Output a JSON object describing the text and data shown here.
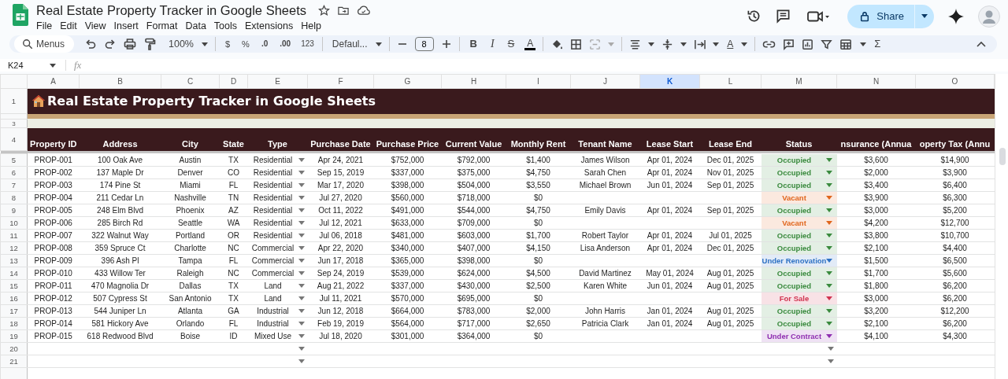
{
  "document": {
    "title": "Real Estate Property Tracker in Google Sheets"
  },
  "menu": [
    "File",
    "Edit",
    "View",
    "Insert",
    "Format",
    "Data",
    "Tools",
    "Extensions",
    "Help"
  ],
  "share": "Share",
  "toolbar": {
    "search_placeholder": "Menus",
    "zoom": "100%",
    "currency": "$",
    "percent": "%",
    "decimal_decrease": ".0",
    "decimal_increase": ".00",
    "number_format": "123",
    "font": "Defaul...",
    "font_size": "8",
    "bold": "B",
    "italic": "I",
    "strikethrough": "S",
    "text_color": "A",
    "text_rotation": "A",
    "functions": "Σ"
  },
  "formula_bar": {
    "name_box": "K24",
    "fx": "fx"
  },
  "columns": [
    {
      "letter": "A",
      "selected": false
    },
    {
      "letter": "B",
      "selected": false
    },
    {
      "letter": "C",
      "selected": false
    },
    {
      "letter": "D",
      "selected": false
    },
    {
      "letter": "E",
      "selected": false
    },
    {
      "letter": "F",
      "selected": false
    },
    {
      "letter": "G",
      "selected": false
    },
    {
      "letter": "H",
      "selected": false
    },
    {
      "letter": "I",
      "selected": false
    },
    {
      "letter": "J",
      "selected": false
    },
    {
      "letter": "K",
      "selected": true
    },
    {
      "letter": "L",
      "selected": false
    },
    {
      "letter": "M",
      "selected": false
    },
    {
      "letter": "N",
      "selected": false
    },
    {
      "letter": "O",
      "selected": false
    }
  ],
  "title_row": {
    "number": "1",
    "title": "Real Estate Property Tracker in Google Sheets"
  },
  "band_row_number": "3",
  "header_row": {
    "number": "4",
    "labels": [
      "Property ID",
      "Address",
      "City",
      "State",
      "Type",
      "Purchase Date",
      "Purchase Price",
      "Current Value",
      "Monthly Rent",
      "Tenant Name",
      "Lease Start",
      "Lease End",
      "Status",
      "nsurance (Annua",
      "operty Tax (Annu"
    ]
  },
  "rows": [
    {
      "number": "5",
      "id": "PROP-001",
      "address": "100 Oak Ave",
      "city": "Austin",
      "state": "TX",
      "type": "Residential",
      "purchase_date": "Apr 24, 2021",
      "purchase_price": "$752,000",
      "current_value": "$792,000",
      "monthly_rent": "$1,400",
      "tenant": "James Wilson",
      "lease_start": "Apr 01, 2024",
      "lease_end": "Dec 01, 2025",
      "status": "Occupied",
      "color": "#3a8a3e",
      "insurance": "$3,600",
      "property_tax": "$14,900"
    },
    {
      "number": "6",
      "id": "PROP-002",
      "address": "137 Maple Dr",
      "city": "Denver",
      "state": "CO",
      "type": "Residential",
      "purchase_date": "Sep 15, 2019",
      "purchase_price": "$337,000",
      "current_value": "$375,000",
      "monthly_rent": "$4,750",
      "tenant": "Sarah Chen",
      "lease_start": "Apr 01, 2024",
      "lease_end": "Nov 01, 2025",
      "status": "Occupied",
      "color": "#3a8a3e",
      "insurance": "$2,000",
      "property_tax": "$3,900"
    },
    {
      "number": "7",
      "id": "PROP-003",
      "address": "174 Pine St",
      "city": "Miami",
      "state": "FL",
      "type": "Residential",
      "purchase_date": "Mar 17, 2020",
      "purchase_price": "$398,000",
      "current_value": "$504,000",
      "monthly_rent": "$3,550",
      "tenant": "Michael Brown",
      "lease_start": "Jun 01, 2024",
      "lease_end": "Sep 01, 2025",
      "status": "Occupied",
      "color": "#3a8a3e",
      "insurance": "$3,400",
      "property_tax": "$6,400"
    },
    {
      "number": "8",
      "id": "PROP-004",
      "address": "211 Cedar Ln",
      "city": "Nashville",
      "state": "TN",
      "type": "Residential",
      "purchase_date": "Jul 27, 2020",
      "purchase_price": "$560,000",
      "current_value": "$718,000",
      "monthly_rent": "$0",
      "status": "Vacant",
      "color": "#e0651c",
      "insurance": "$3,900",
      "property_tax": "$6,300"
    },
    {
      "number": "9",
      "id": "PROP-005",
      "address": "248 Elm Blvd",
      "city": "Phoenix",
      "state": "AZ",
      "type": "Residential",
      "purchase_date": "Oct 11, 2022",
      "purchase_price": "$491,000",
      "current_value": "$544,000",
      "monthly_rent": "$4,750",
      "tenant": "Emily Davis",
      "lease_start": "Apr 01, 2024",
      "lease_end": "Sep 01, 2025",
      "status": "Occupied",
      "color": "#3a8a3e",
      "insurance": "$3,000",
      "property_tax": "$5,200"
    },
    {
      "number": "10",
      "id": "PROP-006",
      "address": "285 Birch Rd",
      "city": "Seattle",
      "state": "WA",
      "type": "Residential",
      "purchase_date": "Jul 12, 2021",
      "purchase_price": "$633,000",
      "current_value": "$709,000",
      "monthly_rent": "$0",
      "status": "Vacant",
      "color": "#e0651c",
      "insurance": "$4,200",
      "property_tax": "$12,700"
    },
    {
      "number": "11",
      "id": "PROP-007",
      "address": "322 Walnut Way",
      "city": "Portland",
      "state": "OR",
      "type": "Residential",
      "purchase_date": "Jul 06, 2018",
      "purchase_price": "$481,000",
      "current_value": "$603,000",
      "monthly_rent": "$1,700",
      "tenant": "Robert Taylor",
      "lease_start": "Apr 01, 2024",
      "lease_end": "Jul 01, 2025",
      "status": "Occupied",
      "color": "#3a8a3e",
      "insurance": "$3,800",
      "property_tax": "$10,700"
    },
    {
      "number": "12",
      "id": "PROP-008",
      "address": "359 Spruce Ct",
      "city": "Charlotte",
      "state": "NC",
      "type": "Commercial",
      "purchase_date": "Apr 22, 2020",
      "purchase_price": "$340,000",
      "current_value": "$407,000",
      "monthly_rent": "$4,150",
      "tenant": "Lisa Anderson",
      "lease_start": "Apr 01, 2024",
      "lease_end": "Dec 01, 2025",
      "status": "Occupied",
      "color": "#3a8a3e",
      "insurance": "$2,100",
      "property_tax": "$4,400"
    },
    {
      "number": "13",
      "id": "PROP-009",
      "address": "396 Ash Pl",
      "city": "Tampa",
      "state": "FL",
      "type": "Commercial",
      "purchase_date": "Jun 17, 2018",
      "purchase_price": "$365,000",
      "current_value": "$398,000",
      "monthly_rent": "$0",
      "status": "Under Renovation",
      "color": "#2f72c4",
      "insurance": "$1,500",
      "property_tax": "$6,500"
    },
    {
      "number": "14",
      "id": "PROP-010",
      "address": "433 Willow Ter",
      "city": "Raleigh",
      "state": "NC",
      "type": "Commercial",
      "purchase_date": "Sep 24, 2019",
      "purchase_price": "$539,000",
      "current_value": "$624,000",
      "monthly_rent": "$4,500",
      "tenant": "David Martinez",
      "lease_start": "May 01, 2024",
      "lease_end": "Aug 01, 2025",
      "status": "Occupied",
      "color": "#3a8a3e",
      "insurance": "$1,700",
      "property_tax": "$5,600"
    },
    {
      "number": "15",
      "id": "PROP-011",
      "address": "470 Magnolia Dr",
      "city": "Dallas",
      "state": "TX",
      "type": "Land",
      "purchase_date": "Aug 21, 2022",
      "purchase_price": "$337,000",
      "current_value": "$430,000",
      "monthly_rent": "$2,500",
      "tenant": "Karen White",
      "lease_start": "Jun 01, 2024",
      "lease_end": "Aug 01, 2025",
      "status": "Occupied",
      "color": "#3a8a3e",
      "insurance": "$1,800",
      "property_tax": "$6,200"
    },
    {
      "number": "16",
      "id": "PROP-012",
      "address": "507 Cypress St",
      "city": "San Antonio",
      "state": "TX",
      "type": "Land",
      "purchase_date": "Jul 11, 2021",
      "purchase_price": "$570,000",
      "current_value": "$695,000",
      "monthly_rent": "$0",
      "status": "For Sale",
      "color": "#d0334f",
      "insurance": "$3,000",
      "property_tax": "$6,200"
    },
    {
      "number": "17",
      "id": "PROP-013",
      "address": "544 Juniper Ln",
      "city": "Atlanta",
      "state": "GA",
      "type": "Industrial",
      "purchase_date": "Jun 12, 2018",
      "purchase_price": "$664,000",
      "current_value": "$783,000",
      "monthly_rent": "$2,000",
      "tenant": "John Harris",
      "lease_start": "Jan 01, 2024",
      "lease_end": "Aug 01, 2025",
      "status": "Occupied",
      "color": "#3a8a3e",
      "insurance": "$3,200",
      "property_tax": "$12,200"
    },
    {
      "number": "18",
      "id": "PROP-014",
      "address": "581 Hickory Ave",
      "city": "Orlando",
      "state": "FL",
      "type": "Industrial",
      "purchase_date": "Feb 19, 2019",
      "purchase_price": "$564,000",
      "current_value": "$717,000",
      "monthly_rent": "$2,650",
      "tenant": "Patricia Clark",
      "lease_start": "Jan 01, 2024",
      "lease_end": "Aug 01, 2025",
      "status": "Occupied",
      "color": "#3a8a3e",
      "insurance": "$2,100",
      "property_tax": "$6,200"
    },
    {
      "number": "19",
      "id": "PROP-015",
      "address": "618 Redwood Blvd",
      "city": "Boise",
      "state": "ID",
      "type": "Mixed Use",
      "purchase_date": "Jul 18, 2020",
      "purchase_price": "$301,000",
      "current_value": "$364,000",
      "monthly_rent": "$0",
      "status": "Under Contract",
      "color": "#8e2fb0",
      "insurance": "$4,100",
      "property_tax": "$4,300"
    }
  ],
  "empty_rows": [
    {
      "number": "20"
    },
    {
      "number": "21"
    }
  ]
}
